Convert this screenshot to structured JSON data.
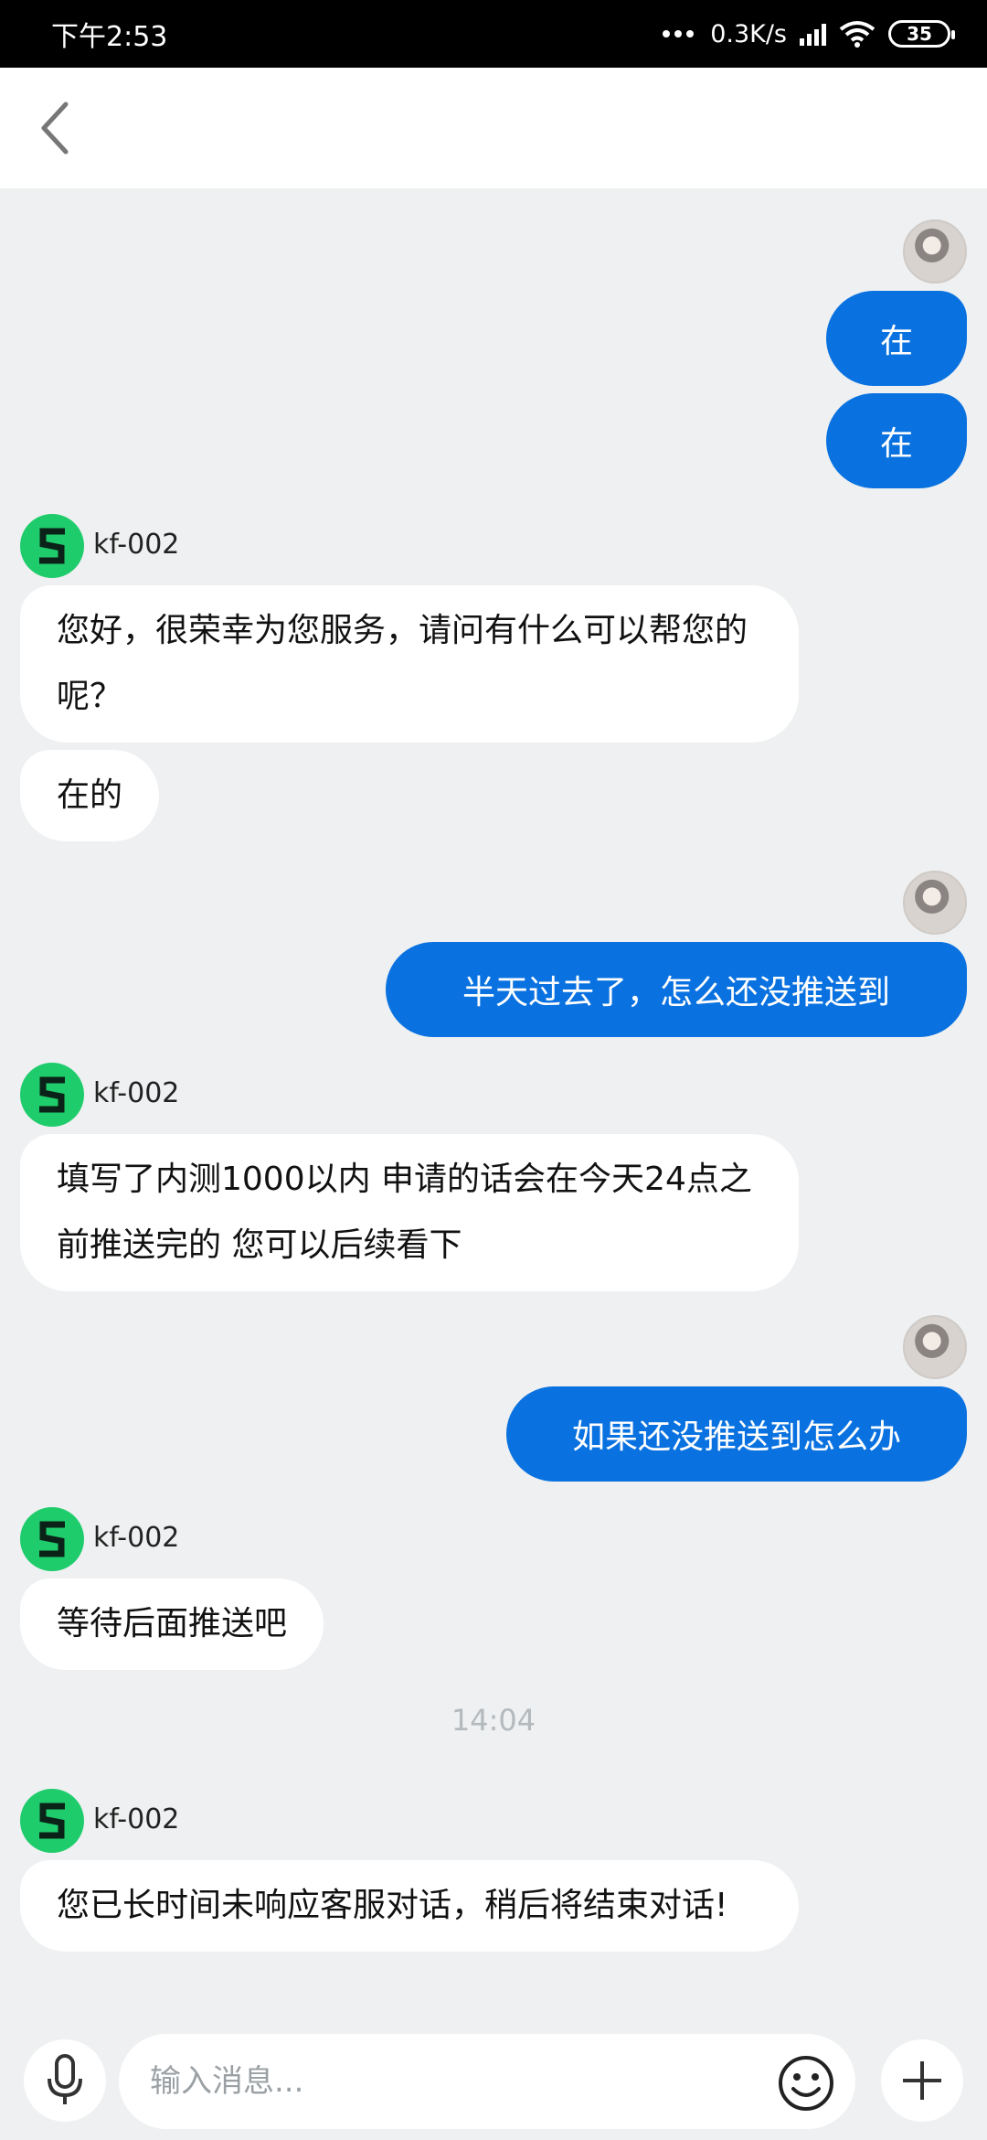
{
  "status_bar": {
    "time": "下午2:53",
    "speed": "0.3K/s",
    "battery": "35"
  },
  "nav": {
    "back_icon": "chevron-left-icon"
  },
  "messages": [
    {
      "from": "user",
      "text": "在"
    },
    {
      "from": "user",
      "text": "在"
    },
    {
      "from": "kf",
      "name": "kf-002",
      "text": "您好，很荣幸为您服务，请问有什么可以帮您的呢？"
    },
    {
      "from": "kf",
      "text": "在的"
    },
    {
      "from": "user",
      "text": "半天过去了，怎么还没推送到"
    },
    {
      "from": "kf",
      "name": "kf-002",
      "text": "填写了内测1000以内 申请的话会在今天24点之前推送完的 您可以后续看下"
    },
    {
      "from": "user",
      "text": "如果还没推送到怎么办"
    },
    {
      "from": "kf",
      "name": "kf-002",
      "text": "等待后面推送吧"
    },
    {
      "timestamp": "14:04"
    },
    {
      "from": "kf",
      "name": "kf-002",
      "text": "您已长时间未响应客服对话，稍后将结束对话!"
    }
  ],
  "input_bar": {
    "placeholder": "输入消息...",
    "mic_icon": "microphone-icon",
    "emoji_icon": "smiley-icon",
    "plus_icon": "plus-icon"
  },
  "colors": {
    "outgoing_bubble": "#0a72e0",
    "agent_avatar": "#1fcc6c",
    "chat_background": "#eef0f1"
  }
}
